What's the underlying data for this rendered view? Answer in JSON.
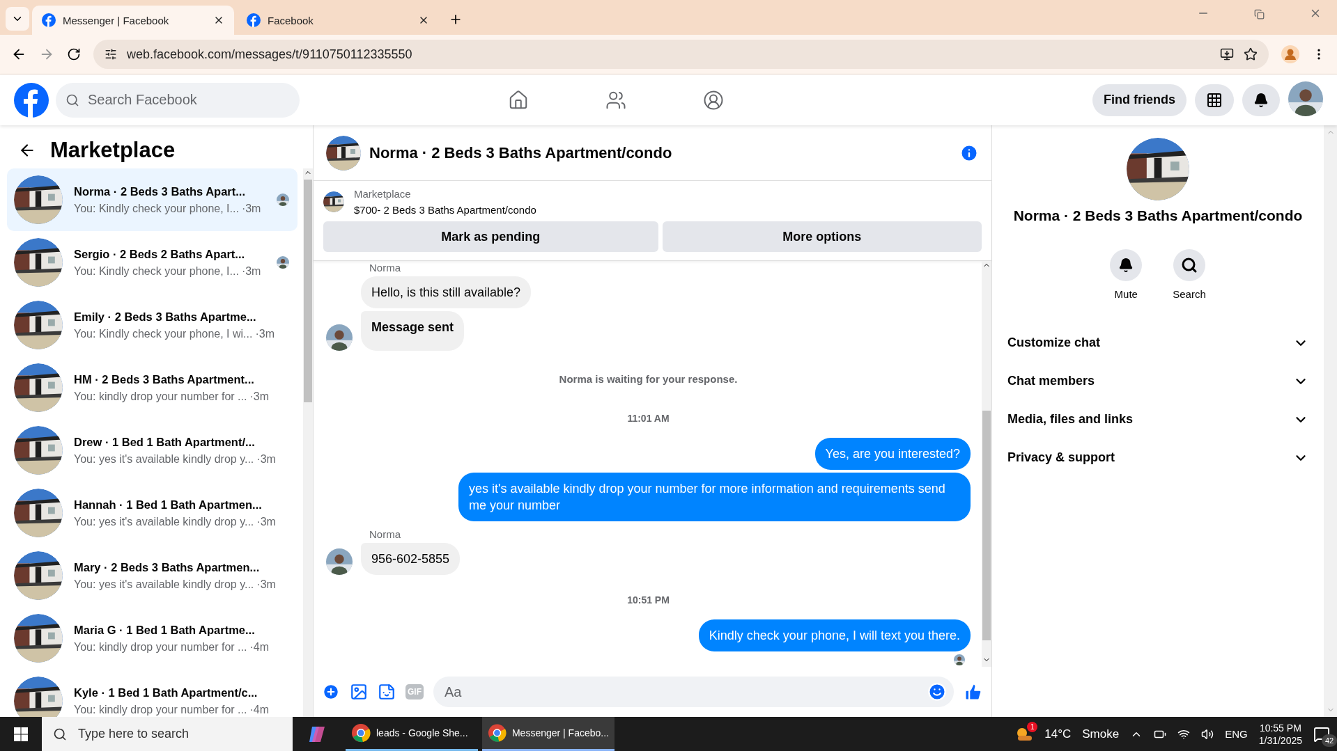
{
  "browser": {
    "tabs": [
      {
        "title": "Messenger | Facebook",
        "selected": true
      },
      {
        "title": "Facebook",
        "selected": false
      }
    ],
    "url": "web.facebook.com/messages/t/9110750112335550"
  },
  "header": {
    "search_placeholder": "Search Facebook",
    "find_friends": "Find friends"
  },
  "sidebar": {
    "title": "Marketplace",
    "conversations": [
      {
        "title": "Norma · 2 Beds 3 Baths Apart...",
        "preview": "You: Kindly check your phone, I...",
        "time": "·3m",
        "selected": true,
        "seen": true
      },
      {
        "title": "Sergio · 2 Beds 2 Baths Apart...",
        "preview": "You: Kindly check your phone, I...",
        "time": "·3m",
        "selected": false,
        "seen": true
      },
      {
        "title": "Emily · 2 Beds 3 Baths Apartme...",
        "preview": "You: Kindly check your phone, I wi...",
        "time": "·3m",
        "selected": false,
        "seen": false
      },
      {
        "title": "HM · 2 Beds 3 Baths Apartment...",
        "preview": "You: kindly drop your number for ...",
        "time": "·3m",
        "selected": false,
        "seen": false
      },
      {
        "title": "Drew · 1 Bed 1 Bath Apartment/...",
        "preview": "You: yes it's available kindly drop y...",
        "time": "·3m",
        "selected": false,
        "seen": false
      },
      {
        "title": "Hannah · 1 Bed 1 Bath Apartmen...",
        "preview": "You: yes it's available kindly drop y...",
        "time": "·3m",
        "selected": false,
        "seen": false
      },
      {
        "title": "Mary · 2 Beds 3 Baths Apartmen...",
        "preview": "You: yes it's available kindly drop y...",
        "time": "·3m",
        "selected": false,
        "seen": false
      },
      {
        "title": "Maria G · 1 Bed 1 Bath Apartme...",
        "preview": "You: kindly drop your number for ...",
        "time": "·4m",
        "selected": false,
        "seen": false
      },
      {
        "title": "Kyle · 1 Bed 1 Bath Apartment/c...",
        "preview": "You: kindly drop your number for ...",
        "time": "·4m",
        "selected": false,
        "seen": false
      }
    ]
  },
  "chat": {
    "title": "Norma · 2 Beds 3 Baths Apartment/condo",
    "listing": {
      "label": "Marketplace",
      "name": "$700- 2 Beds 3 Baths Apartment/condo"
    },
    "actions": [
      "Mark as pending",
      "More options"
    ],
    "messages": [
      {
        "kind": "sender",
        "text": "Norma"
      },
      {
        "kind": "incoming",
        "text": "Hello, is this still available?",
        "avatar": false,
        "strong": false
      },
      {
        "kind": "incoming",
        "text": "Message sent",
        "avatar": true,
        "strong": true
      },
      {
        "kind": "notice",
        "text": "Norma is waiting for your response."
      },
      {
        "kind": "time",
        "text": "11:01 AM"
      },
      {
        "kind": "outgoing",
        "text": "Yes, are you interested?"
      },
      {
        "kind": "outgoing",
        "text": "yes it's available kindly drop your number for more information and requirements send me your number"
      },
      {
        "kind": "sender",
        "text": "Norma"
      },
      {
        "kind": "incoming",
        "text": "956-602-5855",
        "avatar": true,
        "strong": false
      },
      {
        "kind": "time",
        "text": "10:51 PM"
      },
      {
        "kind": "outgoing",
        "text": "Kindly check your phone, I will text you there."
      },
      {
        "kind": "seen"
      }
    ],
    "gif": "GIF",
    "composer_placeholder": "Aa"
  },
  "details": {
    "title": "Norma · 2 Beds 3 Baths Apartment/condo",
    "actions": [
      {
        "kind": "mute",
        "label": "Mute"
      },
      {
        "kind": "search",
        "label": "Search"
      }
    ],
    "sections": [
      "Customize chat",
      "Chat members",
      "Media, files and links",
      "Privacy & support"
    ]
  },
  "taskbar": {
    "search_placeholder": "Type here to search",
    "apps": [
      {
        "label": "leads - Google She...",
        "selected": false
      },
      {
        "label": "Messenger | Facebo...",
        "selected": true
      }
    ],
    "weather_badge": "1",
    "temperature": "14°C",
    "condition": "Smoke",
    "language": "ENG",
    "time": "10:55 PM",
    "date": "1/31/2025",
    "notifications": "42"
  }
}
